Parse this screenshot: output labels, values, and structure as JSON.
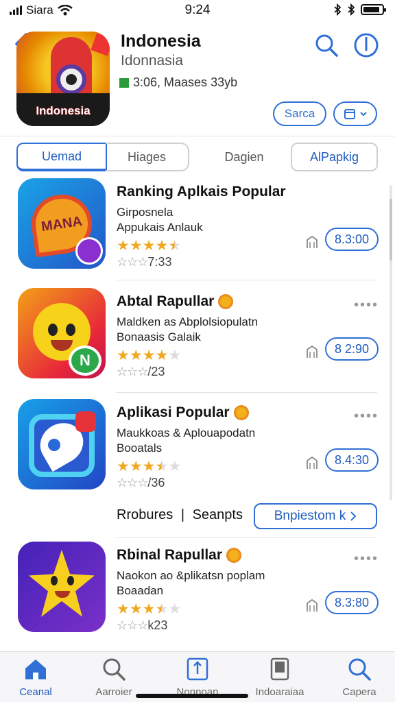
{
  "status_bar": {
    "carrier": "Siara",
    "time": "9:24",
    "battery_level": 0.9
  },
  "header": {
    "title": "Indonesia",
    "subtitle": "Idonnasia",
    "meta": "3:06, Maases 33yb",
    "icon_text": "Indonesia",
    "save_label": "Sarca"
  },
  "tabs": [
    {
      "label": "Uemad",
      "active": true
    },
    {
      "label": "Hiages",
      "active": false
    },
    {
      "label": "Dagien",
      "active": false
    },
    {
      "label": "AlPapkig",
      "active": false
    }
  ],
  "apps": [
    {
      "title": "Ranking Aplkais Popular",
      "sub1": "Girposnela",
      "sub2": "Appukais Anlauk",
      "rating": 4.5,
      "review_prefix": "☆☆☆",
      "review": "7:33",
      "price": "8.3:00",
      "icon_text": "MANA",
      "has_badge": false,
      "has_dots": false
    },
    {
      "title": "Abtal Rapullar",
      "sub1": "Maldken as Abplolsiopulatn",
      "sub2": "Bonaasis Galaik",
      "rating": 4,
      "review_prefix": "☆☆☆",
      "review": "/23",
      "price": "8 2:90",
      "icon_text": "N",
      "has_badge": true,
      "has_dots": true
    },
    {
      "title": "Aplikasi Popular",
      "sub1": "Maukkoas & Aplouapodatn",
      "sub2": "Booatals",
      "rating": 3.5,
      "review_prefix": "☆☆☆",
      "review": "/36",
      "price": "8.4:30",
      "icon_text": "",
      "has_badge": true,
      "has_dots": true
    },
    {
      "title": "Rbinal Rapullar",
      "sub1": "Naokon ao &plikatsn poplam",
      "sub2": "Boaadan",
      "rating": 3.5,
      "review_prefix": "☆☆☆",
      "review": "k23",
      "price": "8.3:80",
      "icon_text": "",
      "has_badge": true,
      "has_dots": true
    }
  ],
  "recommend": {
    "label_a": "Rrobures",
    "label_b": "Seanpts",
    "button_label": "Bnpiestom k"
  },
  "tab_bar": [
    {
      "label": "Ceanal",
      "icon": "home-icon",
      "active": true
    },
    {
      "label": "Aarroier",
      "icon": "search-icon",
      "active": false
    },
    {
      "label": "Nonnoan",
      "icon": "share-icon",
      "active": false
    },
    {
      "label": "Indoaraiaa",
      "icon": "library-icon",
      "active": false
    },
    {
      "label": "Capera",
      "icon": "search-icon",
      "active": false
    }
  ],
  "colors": {
    "accent": "#2f6fd6",
    "star": "#f0a820"
  }
}
